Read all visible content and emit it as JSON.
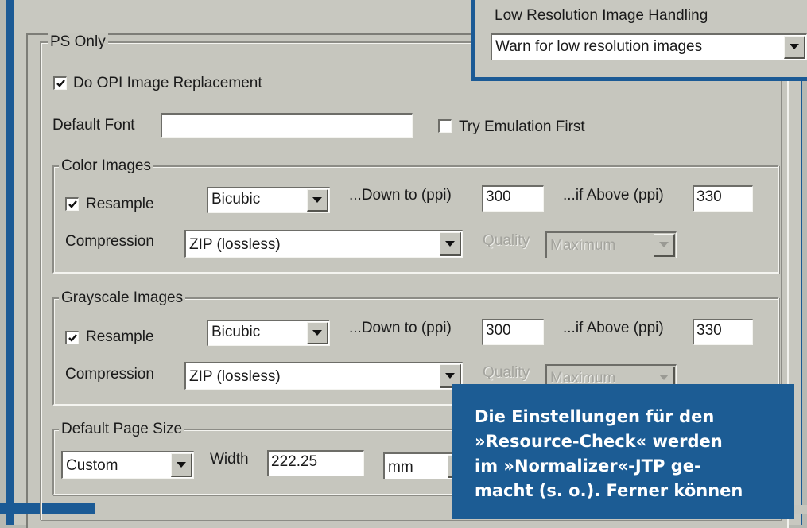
{
  "top_panel": {
    "label": "Low Resolution Image Handling",
    "select_value": "Warn for low resolution images"
  },
  "ps_only": {
    "legend": "PS Only",
    "opi_checkbox_label": "Do OPI Image Replacement",
    "opi_checked": true,
    "default_font_label": "Default Font",
    "default_font_value": "",
    "try_emulation_label": "Try Emulation First",
    "try_emulation_checked": false
  },
  "color_images": {
    "legend": "Color Images",
    "resample_label": "Resample",
    "resample_checked": true,
    "method": "Bicubic",
    "down_to_label": "...Down to (ppi)",
    "down_to_value": "300",
    "if_above_label": "...if Above (ppi)",
    "if_above_value": "330",
    "compression_label": "Compression",
    "compression_value": "ZIP (lossless)",
    "quality_label": "Quality",
    "quality_value": "Maximum"
  },
  "grayscale_images": {
    "legend": "Grayscale Images",
    "resample_label": "Resample",
    "resample_checked": true,
    "method": "Bicubic",
    "down_to_label": "...Down to (ppi)",
    "down_to_value": "300",
    "if_above_label": "...if Above (ppi)",
    "if_above_value": "330",
    "compression_label": "Compression",
    "compression_value": "ZIP (lossless)",
    "quality_label": "Quality",
    "quality_value": "Maximum"
  },
  "page_size": {
    "legend": "Default Page Size",
    "size_value": "Custom",
    "width_label": "Width",
    "width_value": "222.25",
    "unit_value": "mm"
  },
  "caption": {
    "lines": [
      "Die Einstellungen für den",
      "»Resource-Check« werden",
      "im »Normalizer«-JTP ge-",
      "macht (s. o.). Ferner können"
    ]
  },
  "colors": {
    "frame_blue": "#1b5a95",
    "dialog_gray": "#c6c6be",
    "caption_blue": "#1c5c94"
  },
  "icons": [
    "checkmark-icon",
    "dropdown-arrow-icon"
  ]
}
